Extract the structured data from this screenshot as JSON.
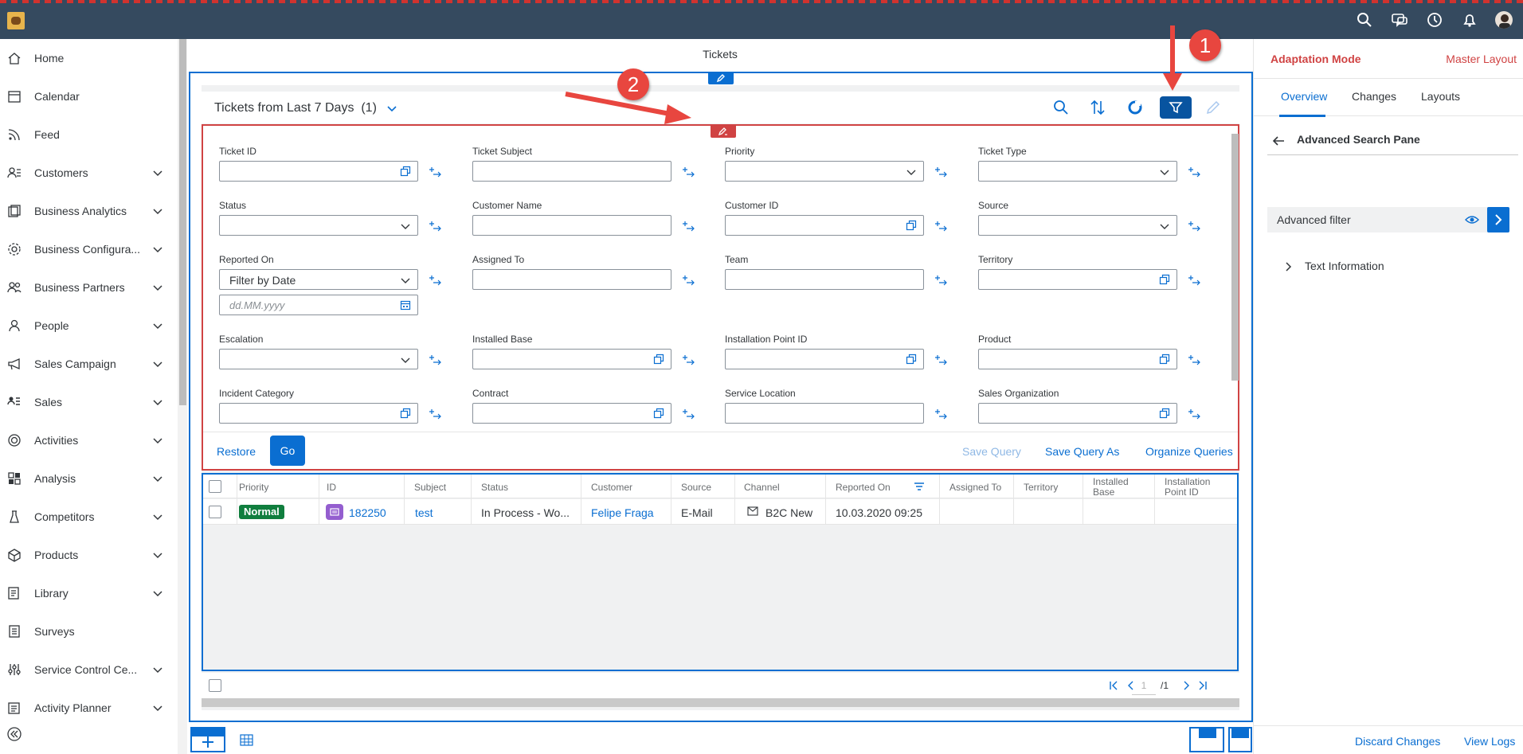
{
  "shell": {
    "icons": [
      "search-icon",
      "chat-icon",
      "clock-icon",
      "bell-icon",
      "user-avatar"
    ]
  },
  "sidebar": {
    "items": [
      {
        "label": "Home",
        "icon": "home-icon",
        "expandable": false
      },
      {
        "label": "Calendar",
        "icon": "calendar-icon",
        "expandable": false
      },
      {
        "label": "Feed",
        "icon": "feed-icon",
        "expandable": false
      },
      {
        "label": "Customers",
        "icon": "customers-icon",
        "expandable": true
      },
      {
        "label": "Business Analytics",
        "icon": "analytics-icon",
        "expandable": true
      },
      {
        "label": "Business Configura...",
        "icon": "configuration-icon",
        "expandable": true
      },
      {
        "label": "Business Partners",
        "icon": "partners-icon",
        "expandable": true
      },
      {
        "label": "People",
        "icon": "person-icon",
        "expandable": true
      },
      {
        "label": "Sales Campaign",
        "icon": "megaphone-icon",
        "expandable": true
      },
      {
        "label": "Sales",
        "icon": "sales-icon",
        "expandable": true
      },
      {
        "label": "Activities",
        "icon": "activities-icon",
        "expandable": true
      },
      {
        "label": "Analysis",
        "icon": "analysis-icon",
        "expandable": true
      },
      {
        "label": "Competitors",
        "icon": "competitors-icon",
        "expandable": true
      },
      {
        "label": "Products",
        "icon": "products-icon",
        "expandable": true
      },
      {
        "label": "Library",
        "icon": "library-icon",
        "expandable": true
      },
      {
        "label": "Surveys",
        "icon": "surveys-icon",
        "expandable": false
      },
      {
        "label": "Service Control Ce...",
        "icon": "service-control-icon",
        "expandable": true
      },
      {
        "label": "Activity Planner",
        "icon": "planner-icon",
        "expandable": true
      }
    ]
  },
  "page": {
    "title": "Tickets"
  },
  "list": {
    "query_title": "Tickets from Last 7 Days",
    "count": "(1)",
    "toolbar_icons": [
      "search-icon",
      "sort-icon",
      "refresh-icon",
      "filter-icon",
      "edit-icon"
    ]
  },
  "filters": {
    "fields": [
      {
        "label": "Ticket ID",
        "type": "valuehelp",
        "value": ""
      },
      {
        "label": "Ticket Subject",
        "type": "text",
        "value": ""
      },
      {
        "label": "Priority",
        "type": "dropdown",
        "value": ""
      },
      {
        "label": "Ticket Type",
        "type": "dropdown",
        "value": ""
      },
      {
        "label": "Status",
        "type": "dropdown",
        "value": ""
      },
      {
        "label": "Customer Name",
        "type": "text",
        "value": ""
      },
      {
        "label": "Customer ID",
        "type": "valuehelp",
        "value": ""
      },
      {
        "label": "Source",
        "type": "dropdown",
        "value": ""
      },
      {
        "label": "Reported On",
        "type": "dropdown",
        "value": "Filter by Date"
      },
      {
        "label": "Assigned To",
        "type": "text",
        "value": ""
      },
      {
        "label": "Team",
        "type": "text",
        "value": ""
      },
      {
        "label": "Territory",
        "type": "valuehelp",
        "value": ""
      },
      {
        "label": "Escalation",
        "type": "dropdown",
        "value": ""
      },
      {
        "label": "Installed Base",
        "type": "valuehelp",
        "value": ""
      },
      {
        "label": "Installation Point ID",
        "type": "valuehelp",
        "value": ""
      },
      {
        "label": "Product",
        "type": "valuehelp",
        "value": ""
      },
      {
        "label": "Incident Category",
        "type": "valuehelp",
        "value": ""
      },
      {
        "label": "Contract",
        "type": "valuehelp",
        "value": ""
      },
      {
        "label": "Service Location",
        "type": "text",
        "value": ""
      },
      {
        "label": "Sales Organization",
        "type": "valuehelp",
        "value": ""
      }
    ],
    "date_placeholder": "dd.MM.yyyy",
    "restore_label": "Restore",
    "go_label": "Go",
    "save_query_label": "Save Query",
    "save_query_as_label": "Save Query As",
    "organize_queries_label": "Organize Queries"
  },
  "table": {
    "columns": [
      "Priority",
      "ID",
      "Subject",
      "Status",
      "Customer",
      "Source",
      "Channel",
      "Reported On",
      "Assigned To",
      "Territory",
      "Installed Base",
      "Installation Point ID"
    ],
    "rows": [
      {
        "priority": "Normal",
        "id": "182250",
        "subject": "test",
        "status": "In Process - Wo...",
        "customer": "Felipe Fraga",
        "source": "E-Mail",
        "channel": "B2C New",
        "reported_on": "10.03.2020 09:25",
        "assigned_to": "",
        "territory": "",
        "installed_base": "",
        "installation_point_id": ""
      }
    ],
    "pagination": {
      "page": "1",
      "total": "/1"
    }
  },
  "right_panel": {
    "mode_label": "Adaptation Mode",
    "layout_label": "Master Layout",
    "tabs": [
      "Overview",
      "Changes",
      "Layouts"
    ],
    "active_tab": "Overview",
    "section_title": "Advanced Search Pane",
    "advanced_filter_label": "Advanced filter",
    "text_information_label": "Text Information",
    "discard_label": "Discard Changes",
    "view_logs_label": "View Logs"
  },
  "annotations": {
    "callout_1": "1",
    "callout_2": "2"
  },
  "colors": {
    "shell": "#354a5f",
    "accent": "#0a6ed1",
    "selected_button": "#0854a0",
    "adaptation_red": "#d04343",
    "priority_normal": "#107e3e",
    "callout": "#e8463f"
  }
}
